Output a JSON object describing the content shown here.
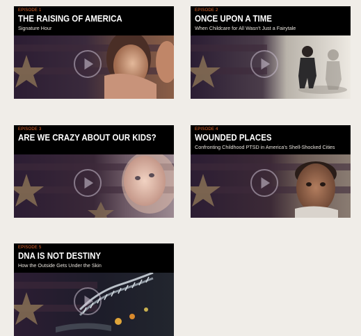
{
  "episodes": [
    {
      "label": "EPISODE 1",
      "title": "THE RAISING OF AMERICA",
      "subtitle": "Signature Hour"
    },
    {
      "label": "EPISODE 2",
      "title": "ONCE UPON A TIME",
      "subtitle": "When Childcare for All Wasn't Just a Fairytale"
    },
    {
      "label": "EPISODE 3",
      "title": "ARE WE CRAZY ABOUT OUR KIDS?",
      "subtitle": ""
    },
    {
      "label": "EPISODE 4",
      "title": "WOUNDED PLACES",
      "subtitle": "Confronting Childhood PTSD in America's Shell-Shocked Cities"
    },
    {
      "label": "EPISODE 5",
      "title": "DNA IS NOT DESTINY",
      "subtitle": "How the Outside Gets Under the Skin"
    }
  ],
  "colors": {
    "page_background": "#f0ede8",
    "header_background": "#000000",
    "episode_label": "#e8682c",
    "title_text": "#ffffff",
    "subtitle_text": "#e9e4de",
    "flag_purple": "#2a1c33",
    "star_tan": "#8c7456"
  },
  "icons": {
    "play": "play-circle-icon"
  }
}
